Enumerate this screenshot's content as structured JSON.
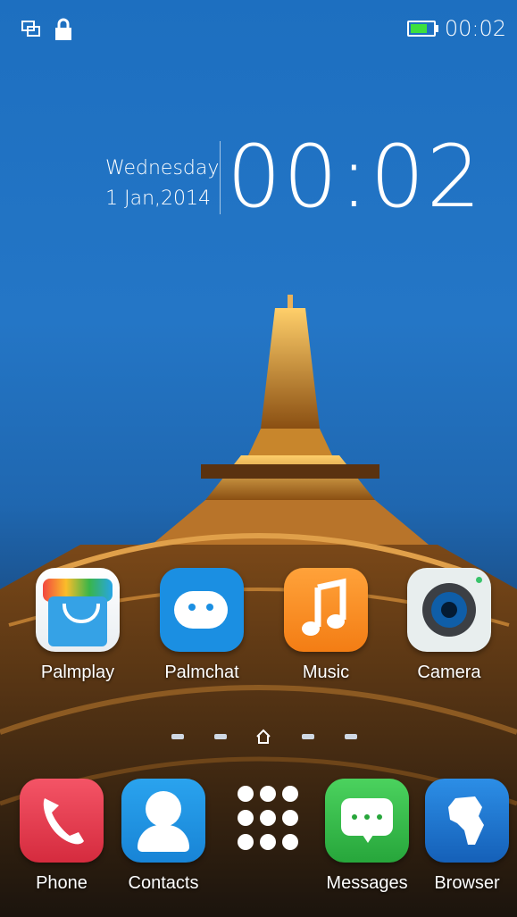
{
  "status_bar": {
    "time": "00:02"
  },
  "clock": {
    "day": "Wednesday",
    "date": "1 Jan,2014",
    "time": "00:02"
  },
  "apps_row": [
    {
      "label": "Palmplay"
    },
    {
      "label": "Palmchat"
    },
    {
      "label": "Music"
    },
    {
      "label": "Camera"
    }
  ],
  "dock": [
    {
      "label": "Phone"
    },
    {
      "label": "Contacts"
    },
    {
      "label": ""
    },
    {
      "label": "Messages"
    },
    {
      "label": "Browser"
    }
  ],
  "colors": {
    "sky": "#1d6fc0",
    "battery": "#3de03d"
  }
}
